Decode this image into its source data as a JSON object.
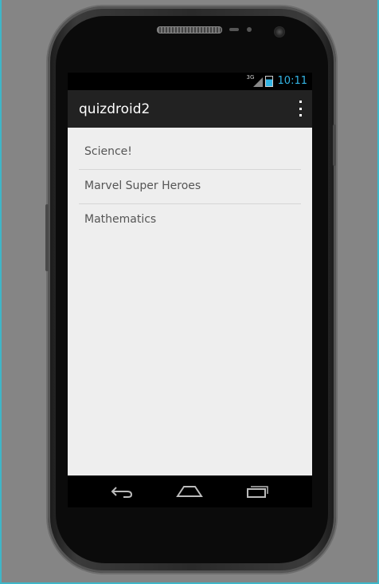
{
  "status_bar": {
    "network_label": "3G",
    "time": "10:11",
    "accent_color": "#33b5e5"
  },
  "action_bar": {
    "title": "quizdroid2",
    "overflow_icon": "overflow-menu-icon"
  },
  "list": {
    "items": [
      {
        "label": "Science!"
      },
      {
        "label": "Marvel Super Heroes"
      },
      {
        "label": "Mathematics"
      }
    ]
  },
  "nav_bar": {
    "buttons": [
      "back-icon",
      "home-icon",
      "recents-icon"
    ]
  }
}
